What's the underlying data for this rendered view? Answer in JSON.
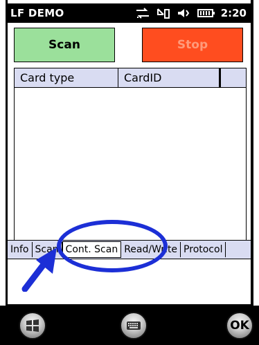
{
  "statusbar": {
    "title": "LF DEMO",
    "time": "2:20"
  },
  "buttons": {
    "scan": "Scan",
    "stop": "Stop"
  },
  "list": {
    "columns": [
      "Card type",
      "CardID",
      ""
    ]
  },
  "tabs": [
    {
      "label": "Info"
    },
    {
      "label": "Scan"
    },
    {
      "label": "Cont. Scan",
      "selected": true
    },
    {
      "label": "Read/Write"
    },
    {
      "label": "Protocol"
    }
  ],
  "softkeys": {
    "ok": "OK"
  },
  "colors": {
    "scan_button": "#9be09b",
    "stop_button": "#ff4d1f",
    "header_bg": "#d9dcf2",
    "annotation": "#1c2fd6"
  }
}
